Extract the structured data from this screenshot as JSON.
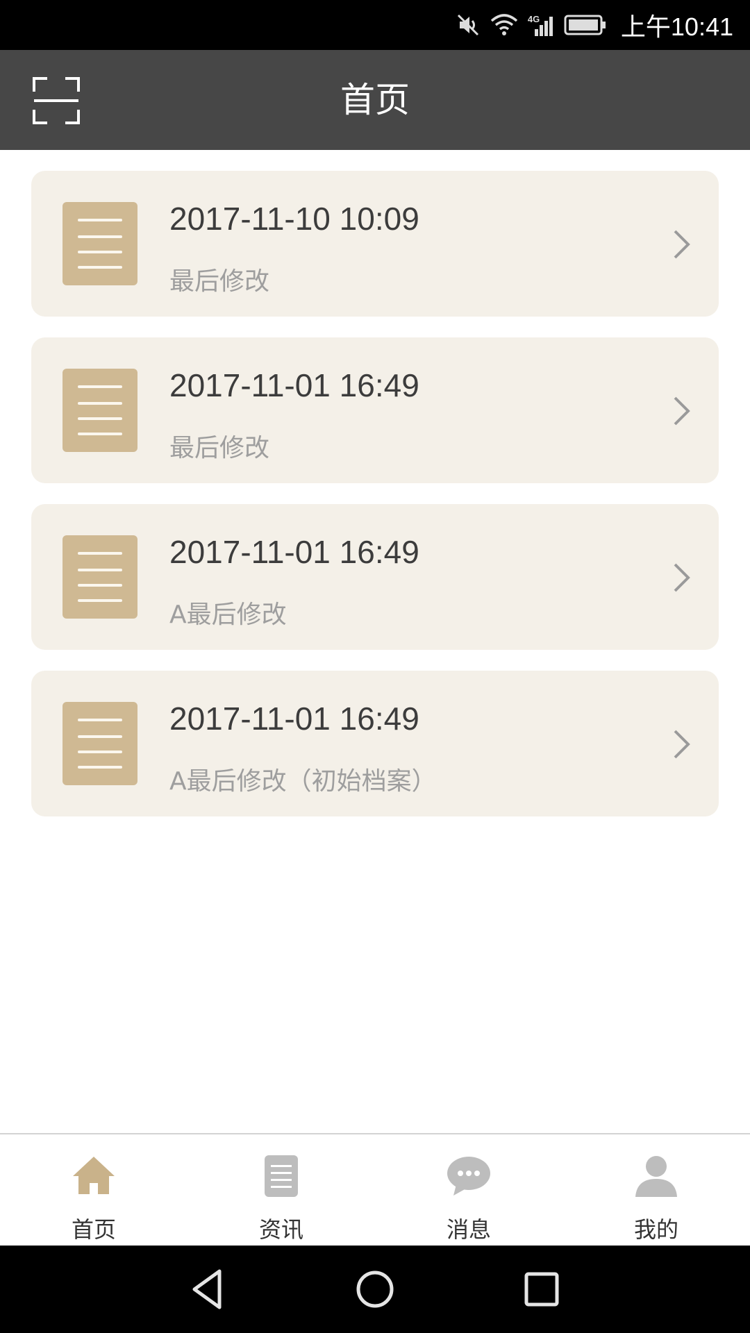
{
  "status_bar": {
    "time": "上午10:41",
    "network": "4G",
    "icons": [
      "mute-icon",
      "wifi-icon",
      "signal-icon",
      "battery-icon"
    ]
  },
  "header": {
    "title": "首页",
    "scan_icon": "scan-icon"
  },
  "records": [
    {
      "date": "2017-11-10 10:09",
      "subtitle": "最后修改"
    },
    {
      "date": "2017-11-01 16:49",
      "subtitle": "最后修改"
    },
    {
      "date": "2017-11-01 16:49",
      "subtitle": "A最后修改"
    },
    {
      "date": "2017-11-01 16:49",
      "subtitle": "A最后修改（初始档案）"
    }
  ],
  "tabs": [
    {
      "label": "首页",
      "icon": "home-icon",
      "active": true
    },
    {
      "label": "资讯",
      "icon": "news-icon",
      "active": false
    },
    {
      "label": "消息",
      "icon": "message-icon",
      "active": false
    },
    {
      "label": "我的",
      "icon": "profile-icon",
      "active": false
    }
  ],
  "colors": {
    "header_bg": "#474747",
    "card_bg": "#f4f0e8",
    "doc_icon": "#cfb993",
    "tab_active": "#c9b28a",
    "tab_inactive": "#bdbdbd"
  }
}
